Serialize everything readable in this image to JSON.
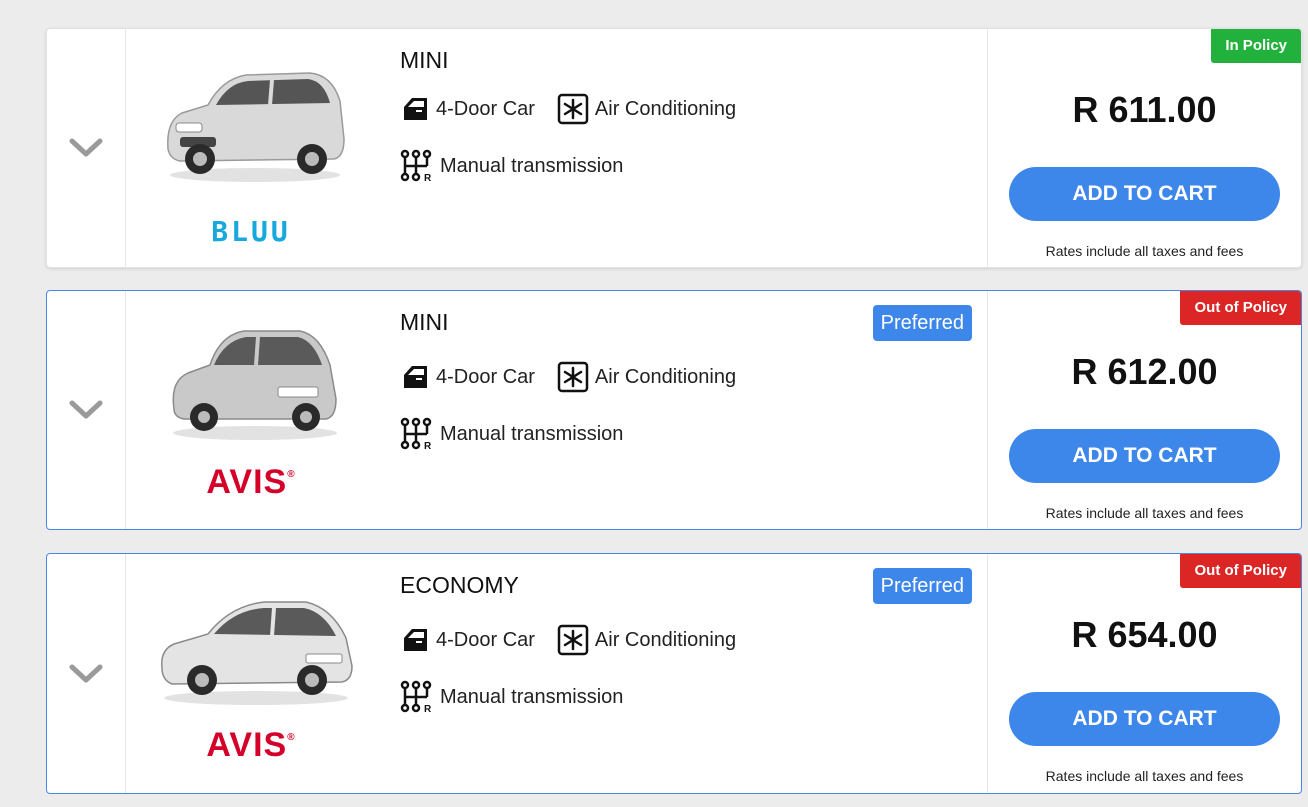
{
  "results": [
    {
      "category": "MINI",
      "features": {
        "doors": "4-Door Car",
        "ac": "Air Conditioning",
        "transmission": "Manual transmission"
      },
      "vendor": "BLUU",
      "policy": "In Policy",
      "preferred": "",
      "price": "R 611.00",
      "cart_label": "ADD TO CART",
      "rates_note": "Rates include all taxes and fees"
    },
    {
      "category": "MINI",
      "features": {
        "doors": "4-Door Car",
        "ac": "Air Conditioning",
        "transmission": "Manual transmission"
      },
      "vendor": "AVIS",
      "vendor_mark": "®",
      "policy": "Out of Policy",
      "preferred": "Preferred",
      "price": "R 612.00",
      "cart_label": "ADD TO CART",
      "rates_note": "Rates include all taxes and fees"
    },
    {
      "category": "ECONOMY",
      "features": {
        "doors": "4-Door Car",
        "ac": "Air Conditioning",
        "transmission": "Manual transmission"
      },
      "vendor": "AVIS",
      "vendor_mark": "®",
      "policy": "Out of Policy",
      "preferred": "Preferred",
      "price": "R 654.00",
      "cart_label": "ADD TO CART",
      "rates_note": "Rates include all taxes and fees"
    }
  ],
  "colors": {
    "accent": "#3d86ea",
    "in_policy": "#23b13e",
    "out_policy": "#dc2626",
    "bluu": "#17a8de",
    "avis": "#d4002a"
  },
  "icons": [
    "chevron-down-icon",
    "door-icon",
    "snowflake-icon",
    "gearshift-icon"
  ]
}
